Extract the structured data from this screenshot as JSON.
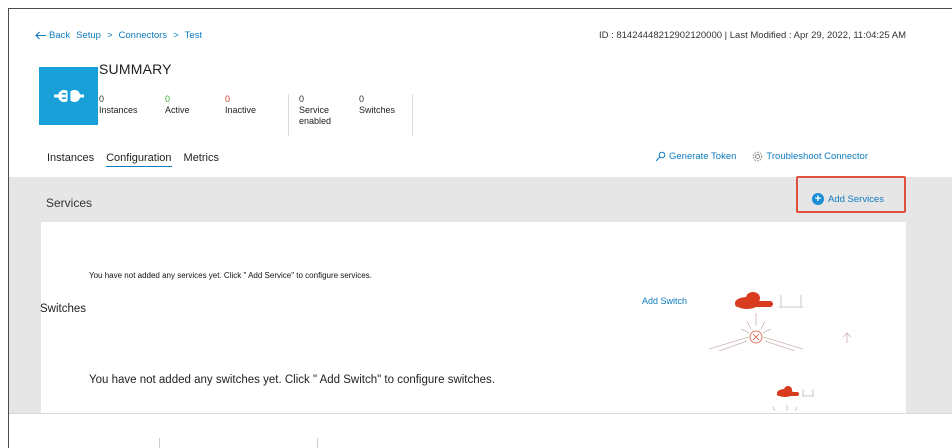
{
  "header": {
    "back_label": "Back",
    "breadcrumb": [
      "Setup",
      "Connectors",
      "Test"
    ],
    "breadcrumb_sep": ">",
    "meta": "ID : 81424448212902120000 | Last Modified : Apr 29, 2022, 11:04:25 AM"
  },
  "summary": {
    "title": "SUMMARY",
    "stats": [
      {
        "value": "0",
        "label": "Instances",
        "color": "#333333"
      },
      {
        "value": "0",
        "label": "Active",
        "color": "#3aa538"
      },
      {
        "value": "0",
        "label": "Inactive",
        "color": "#d83b1e"
      },
      {
        "value": "0",
        "label": "Service enabled",
        "color": "#333333"
      },
      {
        "value": "0",
        "label": "Switches",
        "color": "#333333"
      }
    ]
  },
  "tabs": {
    "items": [
      "Instances",
      "Configuration",
      "Metrics"
    ],
    "active": "Configuration",
    "generate_token": "Generate Token",
    "troubleshoot": "Troubleshoot Connector"
  },
  "services": {
    "title": "Services",
    "add_button": "Add Services",
    "empty_message": "You have not added any services yet. Click \" Add Service\"  to configure services."
  },
  "switches": {
    "title": "Switches",
    "add_button": "Add Switch",
    "empty_message": "You have not added any switches yet.  Click \" Add Switch\"  to configure switches."
  },
  "icons": {
    "back": "arrow-left-icon",
    "logo": "connector-plug-icon",
    "token": "key-icon",
    "troubleshoot": "gear-icon",
    "add": "plus-circle-icon"
  },
  "colors": {
    "accent": "#0d7bbf",
    "logo_bg": "#1aa0d8",
    "highlight": "#e0503c",
    "cloud": "#d83b1e"
  }
}
